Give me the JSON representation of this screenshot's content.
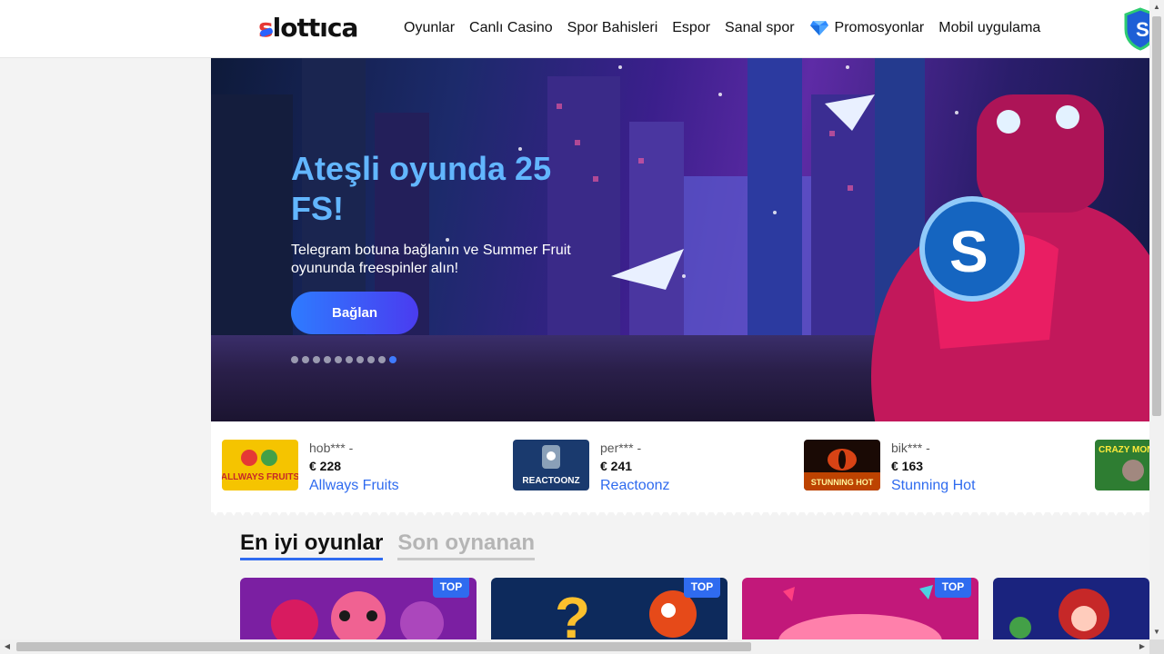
{
  "header": {
    "logo": {
      "a": "s",
      "b": "lottıca"
    },
    "nav": [
      {
        "label": "Oyunlar"
      },
      {
        "label": "Canlı Casino"
      },
      {
        "label": "Spor Bahisleri"
      },
      {
        "label": "Espor"
      },
      {
        "label": "Sanal spor"
      },
      {
        "label": "Promosyonlar",
        "icon": "diamond-icon"
      },
      {
        "label": "Mobil uygulama"
      }
    ]
  },
  "banner": {
    "title": "Ateşli oyunda 25 FS!",
    "subtitle": "Telegram botuna bağlanın ve Summer Fruit oyununda freespinler alın!",
    "button": "Bağlan",
    "slides_total": 10,
    "slide_active": 10
  },
  "winners": [
    {
      "user": "hob*** -",
      "amount": "€ 228",
      "game": "Allways Fruits",
      "thumb": "ALLWAYS FRUITS"
    },
    {
      "user": "per*** -",
      "amount": "€ 241",
      "game": "Reactoonz",
      "thumb": "REACTOONZ"
    },
    {
      "user": "bik*** -",
      "amount": "€ 163",
      "game": "Stunning Hot",
      "thumb": "STUNNING HOT"
    },
    {
      "user": "",
      "amount": "",
      "game": "",
      "thumb": "CRAZY MON"
    }
  ],
  "games_section": {
    "tabs": [
      {
        "label": "En iyi oyunlar",
        "active": true
      },
      {
        "label": "Son oynanan",
        "active": false
      }
    ],
    "badge": "TOP"
  },
  "colors": {
    "accent": "#2f6bef",
    "title_blue": "#62b6ff",
    "logo_red": "#e53935"
  }
}
